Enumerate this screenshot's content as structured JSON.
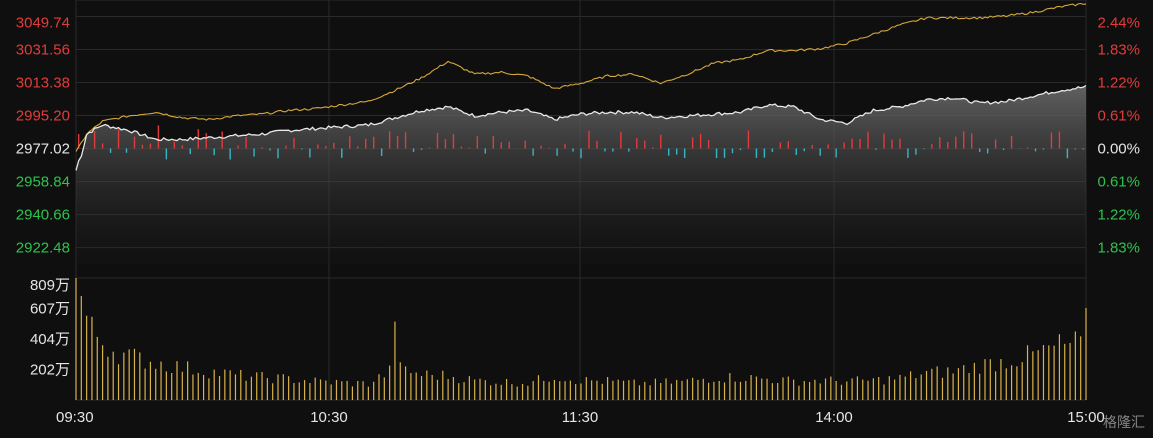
{
  "chart_data": {
    "type": "line",
    "title": "",
    "colors": {
      "background": "#0f0f0f",
      "grid": "#2a2a2a",
      "price_line": "#e8e8e8",
      "avg_line": "#d6a83a",
      "up": "#e23b3b",
      "down": "#36b7c4",
      "volume": "#d8b24a",
      "neutral_text": "#e6e6e6",
      "up_text": "#e23b3b",
      "down_text": "#2ec24c"
    },
    "price_axis": {
      "base": 2977.02,
      "ylim": [
        2913.39,
        3058.83
      ],
      "left_ticks": [
        "3049.74",
        "3031.56",
        "3013.38",
        "2995.20",
        "2977.02",
        "2958.84",
        "2940.66",
        "2922.48"
      ],
      "right_ticks": [
        "2.44%",
        "1.83%",
        "1.22%",
        "0.61%",
        "0.00%",
        "0.61%",
        "1.22%",
        "1.83%"
      ]
    },
    "volume_axis": {
      "ylim": [
        0,
        809
      ],
      "unit": "万",
      "ticks": [
        "809万",
        "607万",
        "404万",
        "202万"
      ]
    },
    "x_ticks": [
      "09:30",
      "10:30",
      "11:30",
      "14:00",
      "15:00"
    ],
    "price_series": {
      "name": "",
      "points": [
        [
          0,
          2965
        ],
        [
          4,
          2985
        ],
        [
          10,
          2990
        ],
        [
          20,
          2987
        ],
        [
          30,
          2982
        ],
        [
          40,
          2982
        ],
        [
          50,
          2983
        ],
        [
          60,
          2984
        ],
        [
          70,
          2985
        ],
        [
          80,
          2987
        ],
        [
          90,
          2988
        ],
        [
          100,
          2989
        ],
        [
          110,
          2990
        ],
        [
          120,
          2994
        ],
        [
          130,
          2998
        ],
        [
          140,
          3000
        ],
        [
          150,
          2995
        ],
        [
          160,
          2997
        ],
        [
          170,
          2998
        ],
        [
          180,
          2993
        ],
        [
          190,
          2996
        ],
        [
          200,
          2997
        ],
        [
          210,
          2997
        ],
        [
          220,
          2994
        ],
        [
          230,
          2995
        ],
        [
          240,
          2996
        ],
        [
          250,
          2997
        ],
        [
          260,
          3001
        ],
        [
          270,
          3000
        ],
        [
          280,
          2993
        ],
        [
          290,
          2991
        ],
        [
          300,
          2998
        ],
        [
          310,
          3000
        ],
        [
          320,
          3004
        ],
        [
          330,
          3005
        ],
        [
          340,
          3002
        ],
        [
          350,
          3003
        ],
        [
          360,
          3006
        ],
        [
          370,
          3009
        ],
        [
          380,
          3011
        ]
      ]
    },
    "avg_series": {
      "name": "",
      "points": [
        [
          0,
          2975
        ],
        [
          4,
          2985
        ],
        [
          10,
          2992
        ],
        [
          20,
          2995
        ],
        [
          30,
          2997
        ],
        [
          40,
          2994
        ],
        [
          50,
          2993
        ],
        [
          60,
          2995
        ],
        [
          70,
          2996
        ],
        [
          80,
          2998
        ],
        [
          90,
          2999
        ],
        [
          100,
          3001
        ],
        [
          110,
          3003
        ],
        [
          120,
          3009
        ],
        [
          130,
          3016
        ],
        [
          140,
          3025
        ],
        [
          150,
          3018
        ],
        [
          160,
          3019
        ],
        [
          170,
          3017
        ],
        [
          180,
          3010
        ],
        [
          190,
          3013
        ],
        [
          200,
          3017
        ],
        [
          210,
          3018
        ],
        [
          220,
          3013
        ],
        [
          230,
          3018
        ],
        [
          240,
          3024
        ],
        [
          250,
          3026
        ],
        [
          260,
          3031
        ],
        [
          270,
          3031
        ],
        [
          280,
          3032
        ],
        [
          290,
          3035
        ],
        [
          300,
          3040
        ],
        [
          310,
          3045
        ],
        [
          320,
          3049
        ],
        [
          330,
          3049
        ],
        [
          340,
          3049
        ],
        [
          350,
          3050
        ],
        [
          360,
          3052
        ],
        [
          370,
          3055
        ],
        [
          380,
          3057
        ]
      ]
    },
    "volume_series": {
      "name": "",
      "unit": "万",
      "points": [
        [
          0,
          809
        ],
        [
          5,
          480
        ],
        [
          10,
          390
        ],
        [
          15,
          320
        ],
        [
          20,
          290
        ],
        [
          30,
          250
        ],
        [
          40,
          215
        ],
        [
          50,
          190
        ],
        [
          60,
          165
        ],
        [
          70,
          150
        ],
        [
          80,
          140
        ],
        [
          90,
          125
        ],
        [
          100,
          115
        ],
        [
          110,
          108
        ],
        [
          119,
          200
        ],
        [
          120,
          520
        ],
        [
          121,
          210
        ],
        [
          130,
          170
        ],
        [
          140,
          160
        ],
        [
          150,
          130
        ],
        [
          160,
          120
        ],
        [
          170,
          115
        ],
        [
          180,
          160
        ],
        [
          190,
          130
        ],
        [
          200,
          125
        ],
        [
          210,
          110
        ],
        [
          220,
          115
        ],
        [
          230,
          125
        ],
        [
          240,
          150
        ],
        [
          250,
          150
        ],
        [
          260,
          140
        ],
        [
          270,
          125
        ],
        [
          280,
          130
        ],
        [
          290,
          125
        ],
        [
          300,
          130
        ],
        [
          310,
          145
        ],
        [
          320,
          180
        ],
        [
          330,
          190
        ],
        [
          340,
          230
        ],
        [
          350,
          260
        ],
        [
          360,
          300
        ],
        [
          370,
          360
        ],
        [
          379,
          380
        ],
        [
          380,
          610
        ]
      ]
    },
    "watermark": "格隆汇"
  }
}
